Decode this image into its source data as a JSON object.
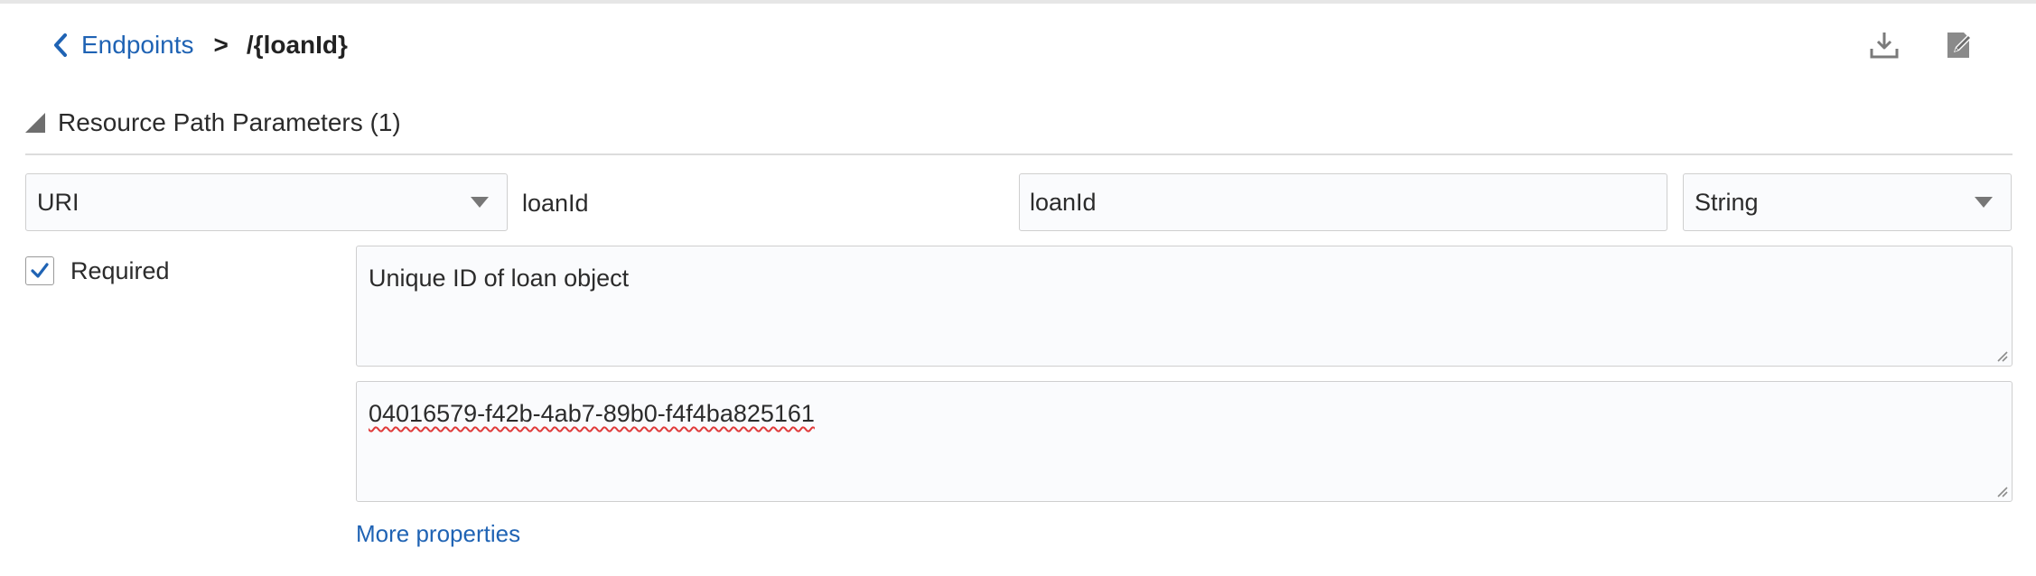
{
  "breadcrumb": {
    "back_label": "Endpoints",
    "separator": ">",
    "current": "/{loanId}"
  },
  "toolbar": {
    "download_icon": "download-icon",
    "edit_icon": "edit-icon"
  },
  "section": {
    "title": "Resource Path Parameters (1)"
  },
  "parameter": {
    "location_value": "URI",
    "name_text": "loanId",
    "display_name_value": "loanId",
    "type_value": "String",
    "required_label": "Required",
    "required_checked": true,
    "description_value": "Unique ID of loan object",
    "example_value": "04016579-f42b-4ab7-89b0-f4f4ba825161"
  },
  "more_properties_label": "More properties",
  "colors": {
    "link": "#1f63b4",
    "field_border": "#cfcfcf",
    "field_bg": "#fafbfd"
  }
}
